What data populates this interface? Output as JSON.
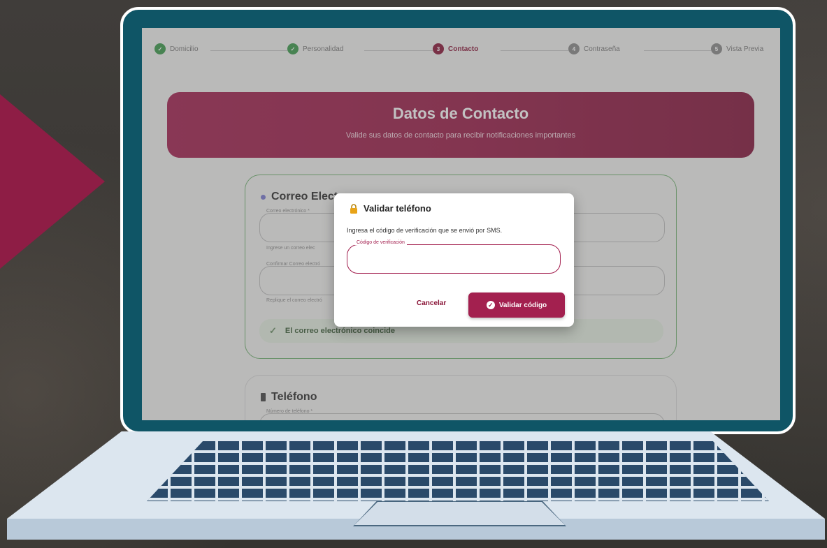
{
  "stepper": {
    "steps": [
      {
        "label": "Domicilio",
        "state": "done"
      },
      {
        "label": "Personalidad",
        "state": "done"
      },
      {
        "label": "Contacto",
        "state": "active",
        "number": "3"
      },
      {
        "label": "Contraseña",
        "state": "todo",
        "number": "4"
      },
      {
        "label": "Vista Previa",
        "state": "todo",
        "number": "5"
      }
    ]
  },
  "header": {
    "title": "Datos de Contacto",
    "subtitle": "Valide sus datos de contacto para recibir notificaciones importantes"
  },
  "email_card": {
    "title": "Correo Electr",
    "email_label": "Correo electrónico *",
    "email_helper": "Ingrese un correo elec",
    "confirm_label": "Confirmar Correo electró",
    "confirm_helper": "Replique el correo electró",
    "match_message": "El correo electrónico coincide"
  },
  "phone_card": {
    "title": "Teléfono",
    "phone_label": "Número de teléfono *"
  },
  "dialog": {
    "title": "Validar teléfono",
    "message": "Ingresa el código de verificación que se envió por SMS.",
    "code_label": "Código de verificación",
    "code_value": "",
    "cancel_label": "Cancelar",
    "validate_label": "Validar código"
  },
  "colors": {
    "brand": "#a3204f",
    "brand_dark": "#8a1538",
    "success": "#3a9a4b",
    "laptop_frame": "#0f5566"
  }
}
